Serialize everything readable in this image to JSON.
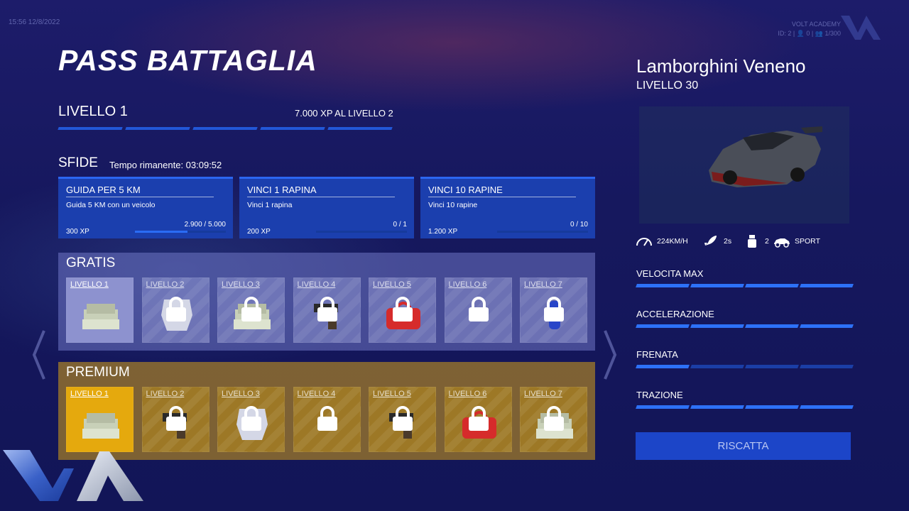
{
  "hud": {
    "time": "15:56 12/8/2022",
    "brand": "VOLT ACADEMY",
    "info": "ID: 2 | 👤 0 | 👥 1/300"
  },
  "pass": {
    "title": "PASS BATTAGLIA",
    "level": "LIVELLO 1",
    "xp_next": "7.000 XP AL LIVELLO 2",
    "level_progress_segments_filled": 5
  },
  "challenges": {
    "header": "SFIDE",
    "timer": "Tempo rimanente: 03:09:52",
    "cards": [
      {
        "title": "GUIDA PER 5 KM",
        "desc": "Guida 5 KM con un veicolo",
        "xp": "300 XP",
        "progress": "2.900 / 5.000",
        "fraction": 0.58
      },
      {
        "title": "VINCI 1 RAPINA",
        "desc": "Vinci 1 rapina",
        "xp": "200 XP",
        "progress": "0 / 1",
        "fraction": 0
      },
      {
        "title": "VINCI 10 RAPINE",
        "desc": "Vinci 10 rapine",
        "xp": "1.200 XP",
        "progress": "0 / 10",
        "fraction": 0
      }
    ]
  },
  "free": {
    "header": "GRATIS",
    "items": [
      {
        "label": "LIVELLO 1",
        "icon": "cash-icon",
        "locked": false
      },
      {
        "label": "LIVELLO 2",
        "icon": "armor-icon",
        "locked": true
      },
      {
        "label": "LIVELLO 3",
        "icon": "cash-icon",
        "locked": true
      },
      {
        "label": "LIVELLO 4",
        "icon": "pistol-icon",
        "locked": true
      },
      {
        "label": "LIVELLO 5",
        "icon": "bag-icon",
        "locked": true
      },
      {
        "label": "LIVELLO 6",
        "icon": "empty",
        "locked": true
      },
      {
        "label": "LIVELLO 7",
        "icon": "bottle-icon",
        "locked": true
      }
    ]
  },
  "premium": {
    "header": "PREMIUM",
    "items": [
      {
        "label": "LIVELLO 1",
        "icon": "cash-icon",
        "locked": false
      },
      {
        "label": "LIVELLO 2",
        "icon": "pistol-icon",
        "locked": true
      },
      {
        "label": "LIVELLO 3",
        "icon": "armor-icon",
        "locked": true
      },
      {
        "label": "LIVELLO 4",
        "icon": "empty",
        "locked": true
      },
      {
        "label": "LIVELLO 5",
        "icon": "pistol-icon",
        "locked": true
      },
      {
        "label": "LIVELLO 6",
        "icon": "bag-icon",
        "locked": true
      },
      {
        "label": "LIVELLO 7",
        "icon": "cash-icon",
        "locked": true
      }
    ]
  },
  "reward": {
    "car_name": "Lamborghini Veneno",
    "car_level": "LIVELLO 30",
    "specs": {
      "speed": "224KM/H",
      "accel": "2s",
      "seats": "2",
      "class": "SPORT"
    },
    "stats": [
      {
        "label": "VELOCITA MAX",
        "value": 1.0
      },
      {
        "label": "ACCELERAZIONE",
        "value": 1.0
      },
      {
        "label": "FRENATA",
        "value": 0.25
      },
      {
        "label": "TRAZIONE",
        "value": 1.0
      }
    ],
    "button": "RISCATTA"
  },
  "colors": {
    "accent": "#2d71f7",
    "premium": "#e5a90d",
    "free": "#8d92cf"
  }
}
